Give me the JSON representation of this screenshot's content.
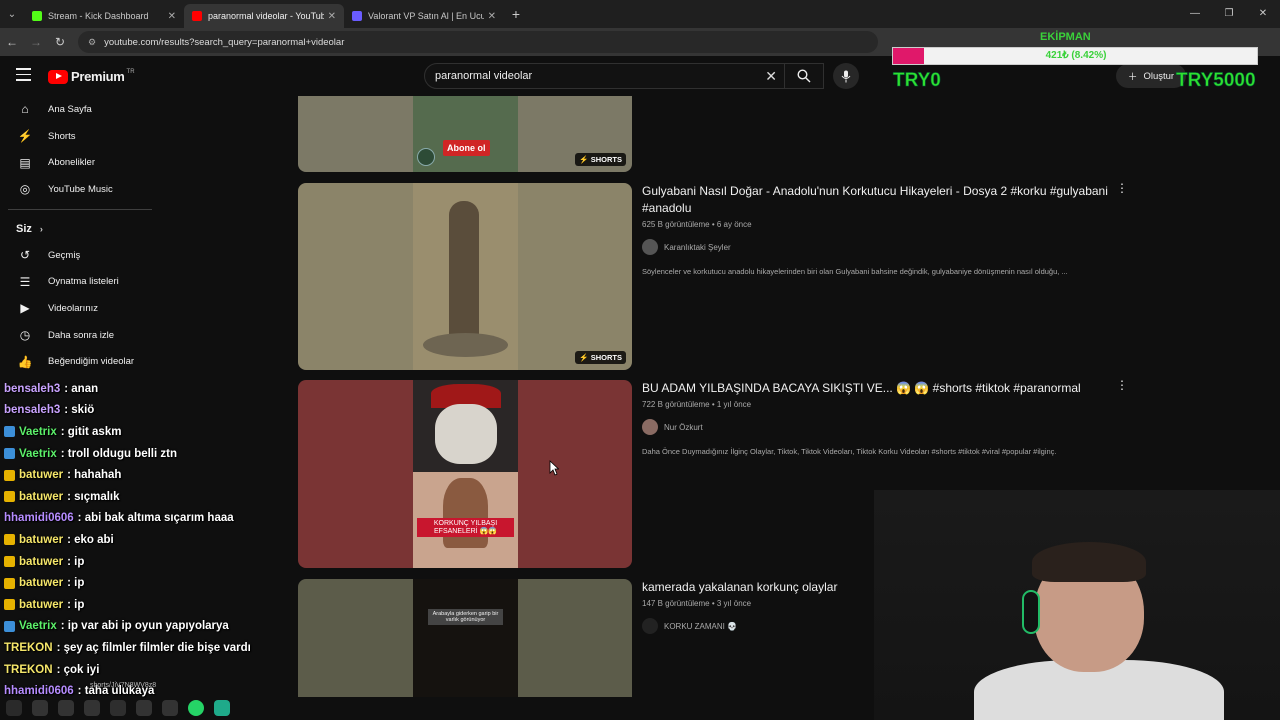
{
  "browser": {
    "tabs": [
      {
        "title": "Stream - Kick Dashboard",
        "color": "#53fc18",
        "active": false
      },
      {
        "title": "paranormal videolar - YouTube",
        "color": "#ff0000",
        "active": true
      },
      {
        "title": "Valorant VP Satın Al | En Ucuz V",
        "color": "#6a5cff",
        "active": false
      }
    ],
    "url": "youtube.com/results?search_query=paranormal+videolar"
  },
  "youtube": {
    "logo_text": "Premium",
    "country_code": "TR",
    "search_value": "paranormal videolar",
    "create_label": "Oluştur"
  },
  "sidebar": {
    "items": [
      {
        "label": "Ana Sayfa",
        "icon": "home-icon"
      },
      {
        "label": "Shorts",
        "icon": "shorts-icon"
      },
      {
        "label": "Abonelikler",
        "icon": "subscriptions-icon"
      },
      {
        "label": "YouTube Music",
        "icon": "music-icon"
      }
    ],
    "you_header": "Siz",
    "you_items": [
      {
        "label": "Geçmiş",
        "icon": "history-icon"
      },
      {
        "label": "Oynatma listeleri",
        "icon": "playlist-icon"
      },
      {
        "label": "Videolarınız",
        "icon": "your-videos-icon"
      },
      {
        "label": "Daha sonra izle",
        "icon": "watch-later-icon"
      },
      {
        "label": "Beğendiğim videolar",
        "icon": "liked-icon"
      }
    ]
  },
  "results": [
    {
      "title": "",
      "badge": "SHORTS",
      "thumb_text": "Abone ol"
    },
    {
      "title": "Gulyabani Nasıl Doğar - Anadolu'nun Korkutucu Hikayeleri - Dosya 2 #korku #gulyabani #anadolu",
      "stats": "625 B görüntüleme • 6 ay önce",
      "channel": "Karanlıktaki Şeyler",
      "description": "Söylenceler ve korkutucu anadolu hikayelerinden biri olan Gulyabani bahsine değindik, gulyabaniye dönüşmenin nasıl olduğu, ...",
      "badge": "SHORTS"
    },
    {
      "title": "BU ADAM YILBAŞINDA BACAYA SIKIŞTI VE... 😱 😱 #shorts #tiktok #paranormal",
      "stats": "722 B görüntüleme • 1 yıl önce",
      "channel": "Nur Özkurt",
      "description": "Daha Önce Duymadığınız İlginç Olaylar, Tiktok, Tiktok Videoları, Tiktok Korku Videoları #shorts #tiktok #viral #popular #ilginç.",
      "thumb_text": "KORKUNÇ YILBAŞI EFSANELERİ 😱😱"
    },
    {
      "title": "kamerada yakalanan korkunç olaylar",
      "stats": "147 B görüntüleme • 3 yıl önce",
      "channel": "KORKU ZAMANI 💀",
      "thumb_text": "Arabayla giderken garip bir varlık görünüyor"
    }
  ],
  "overlay": {
    "goal_label": "EKİPMAN",
    "goal_value": "421₺ (8.42%)",
    "goal_progress": 0.0842,
    "try_left": "TRY0",
    "try_right": "TRY5000"
  },
  "chat": [
    {
      "user": "bensaleh3",
      "text": "anan",
      "color": "#c9a3ff",
      "badge": ""
    },
    {
      "user": "bensaleh3",
      "text": "skiö",
      "color": "#c9a3ff",
      "badge": ""
    },
    {
      "user": "Vaetrix",
      "text": "gitit askm",
      "color": "#5cf06a",
      "badge": "#3c8fd8"
    },
    {
      "user": "Vaetrix",
      "text": "troll oldugu belli ztn",
      "color": "#5cf06a",
      "badge": "#3c8fd8"
    },
    {
      "user": "batuwer",
      "text": "hahahah",
      "color": "#f5e66a",
      "badge": "#e6b200"
    },
    {
      "user": "batuwer",
      "text": "sıçmalık",
      "color": "#f5e66a",
      "badge": "#e6b200"
    },
    {
      "user": "hhamidi0606",
      "text": "abi bak altıma sıçarım haaa",
      "color": "#b68cff",
      "badge": ""
    },
    {
      "user": "batuwer",
      "text": "eko abi",
      "color": "#f5e66a",
      "badge": "#e6b200"
    },
    {
      "user": "batuwer",
      "text": "ip",
      "color": "#f5e66a",
      "badge": "#e6b200"
    },
    {
      "user": "batuwer",
      "text": "ip",
      "color": "#f5e66a",
      "badge": "#e6b200"
    },
    {
      "user": "batuwer",
      "text": "ip",
      "color": "#f5e66a",
      "badge": "#e6b200"
    },
    {
      "user": "Vaetrix",
      "text": "ip var abi ip oyun yapıyolarya",
      "color": "#5cf06a",
      "badge": "#3c8fd8"
    },
    {
      "user": "TREKON",
      "text": "şey aç filmler filmler die bişe vardı",
      "color": "#f5e66a",
      "badge": ""
    },
    {
      "user": "TREKON",
      "text": "çok iyi",
      "color": "#f5e66a",
      "badge": ""
    },
    {
      "user": "hhamidi0606",
      "text": "taha ulukaya",
      "color": "#b68cff",
      "badge": ""
    }
  ],
  "status_url": "shorts/JiV7N8WV8z8"
}
